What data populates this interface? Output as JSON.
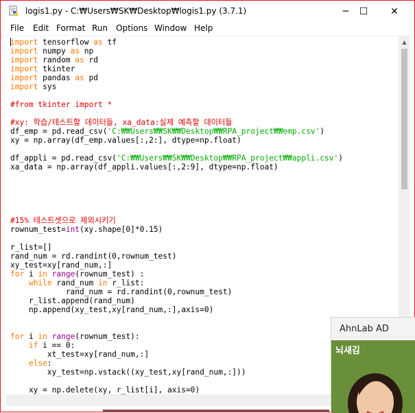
{
  "window": {
    "title": "logis1.py - C:₩Users₩SK₩Desktop₩logis1.py (3.7.1)",
    "controls": {
      "minimize": "─",
      "maximize": "☐",
      "close": "✕"
    }
  },
  "menu": [
    "File",
    "Edit",
    "Format",
    "Run",
    "Options",
    "Window",
    "Help"
  ],
  "code": [
    [
      [
        "kw",
        "import"
      ],
      [
        "t",
        " tensorflow "
      ],
      [
        "kw",
        "as"
      ],
      [
        "t",
        " tf"
      ]
    ],
    [
      [
        "kw",
        "import"
      ],
      [
        "t",
        " numpy "
      ],
      [
        "kw",
        "as"
      ],
      [
        "t",
        " np"
      ]
    ],
    [
      [
        "kw",
        "import"
      ],
      [
        "t",
        " random "
      ],
      [
        "kw",
        "as"
      ],
      [
        "t",
        " rd"
      ]
    ],
    [
      [
        "kw",
        "import"
      ],
      [
        "t",
        " tkinter"
      ]
    ],
    [
      [
        "kw",
        "import"
      ],
      [
        "t",
        " pandas "
      ],
      [
        "kw",
        "as"
      ],
      [
        "t",
        " pd"
      ]
    ],
    [
      [
        "kw",
        "import"
      ],
      [
        "t",
        " sys"
      ]
    ],
    [],
    [
      [
        "cm",
        "#from tkinter import *"
      ]
    ],
    [],
    [
      [
        "cm",
        "#xy: 학습/테스트할 데이터들, xa_data:실제 예측할 데이터들"
      ]
    ],
    [
      [
        "t",
        "df_emp = pd.read_csv("
      ],
      [
        "st",
        "'C:₩₩Users₩₩SK₩₩Desktop₩₩RPA_project₩₩emp.csv'"
      ],
      [
        "t",
        ")"
      ]
    ],
    [
      [
        "t",
        "xy = np.array(df_emp.values[:,2:], dtype=np.float)"
      ]
    ],
    [],
    [
      [
        "t",
        "df_appli = pd.read_csv("
      ],
      [
        "st",
        "'C:₩₩Users₩₩SK₩₩Desktop₩₩RPA_project₩₩appli.csv'"
      ],
      [
        "t",
        ")"
      ]
    ],
    [
      [
        "t",
        "xa_data = np.array(df_appli.values[:,2:9], dtype=np.float)"
      ]
    ],
    [],
    [],
    [],
    [],
    [],
    [
      [
        "cm",
        "#15% 테스트셋으로 제외시키기"
      ]
    ],
    [
      [
        "t",
        "rownum_test="
      ],
      [
        "bi",
        "int"
      ],
      [
        "t",
        "(xy.shape[0]*0.15)"
      ]
    ],
    [],
    [
      [
        "t",
        "r_list=[]"
      ]
    ],
    [
      [
        "t",
        "rand_num = rd.randint(0,rownum_test)"
      ]
    ],
    [
      [
        "t",
        "xy_test=xy[rand_num,:]"
      ]
    ],
    [
      [
        "kw",
        "for"
      ],
      [
        "t",
        " i "
      ],
      [
        "kw",
        "in"
      ],
      [
        "t",
        " "
      ],
      [
        "bi",
        "range"
      ],
      [
        "t",
        "(rownum_test) :"
      ]
    ],
    [
      [
        "t",
        "    "
      ],
      [
        "kw",
        "while"
      ],
      [
        "t",
        " rand_num "
      ],
      [
        "kw",
        "in"
      ],
      [
        "t",
        " r_list:"
      ]
    ],
    [
      [
        "t",
        "            rand_num = rd.randint(0,rownum_test)"
      ]
    ],
    [
      [
        "t",
        "    r_list.append(rand_num)"
      ]
    ],
    [
      [
        "t",
        "    np.append(xy_test,xy[rand_num,:],axis=0)"
      ]
    ],
    [],
    [],
    [
      [
        "kw",
        "for"
      ],
      [
        "t",
        " i "
      ],
      [
        "kw",
        "in"
      ],
      [
        "t",
        " "
      ],
      [
        "bi",
        "range"
      ],
      [
        "t",
        "(rownum_test):"
      ]
    ],
    [
      [
        "t",
        "    "
      ],
      [
        "kw",
        "if"
      ],
      [
        "t",
        " i == 0:"
      ]
    ],
    [
      [
        "t",
        "        xt_test=xy[rand_num,:]"
      ]
    ],
    [
      [
        "t",
        "    "
      ],
      [
        "kw",
        "else"
      ],
      [
        "t",
        ":"
      ]
    ],
    [
      [
        "t",
        "        xy_test=np.vstack((xy_test,xy[rand_num,:]))"
      ]
    ],
    [],
    [
      [
        "t",
        "    xy = np.delete(xy, r_list[i], axis=0)"
      ]
    ]
  ],
  "ad": {
    "title": "AhnLab AD",
    "image_text": "뇌새김"
  },
  "colors": {
    "keyword": "#ff7700",
    "builtin": "#900090",
    "string": "#00aa00",
    "comment": "#dd0000",
    "window_border": "#e81123"
  }
}
